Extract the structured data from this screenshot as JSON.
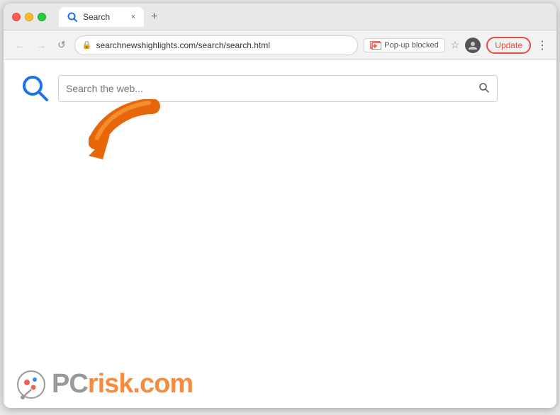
{
  "browser": {
    "tab": {
      "title": "Search",
      "close_label": "×",
      "new_tab_label": "+"
    },
    "address_bar": {
      "url": "searchnewshighlights.com/search/search.html",
      "back_label": "←",
      "forward_label": "→",
      "reload_label": "↺",
      "popup_blocked_label": "Pop-up blocked",
      "bookmark_label": "☆",
      "update_label": "Update",
      "menu_label": "⋮"
    }
  },
  "page": {
    "search_placeholder": "Search the web...",
    "search_icon_label": "🔍",
    "submit_icon_label": "🔍"
  },
  "watermark": {
    "brand": "PC",
    "suffix": "risk.com"
  },
  "colors": {
    "accent": "#e74c3c",
    "orange": "#f47920",
    "blue_logo": "#1a73e8",
    "arrow": "#e8660a"
  }
}
